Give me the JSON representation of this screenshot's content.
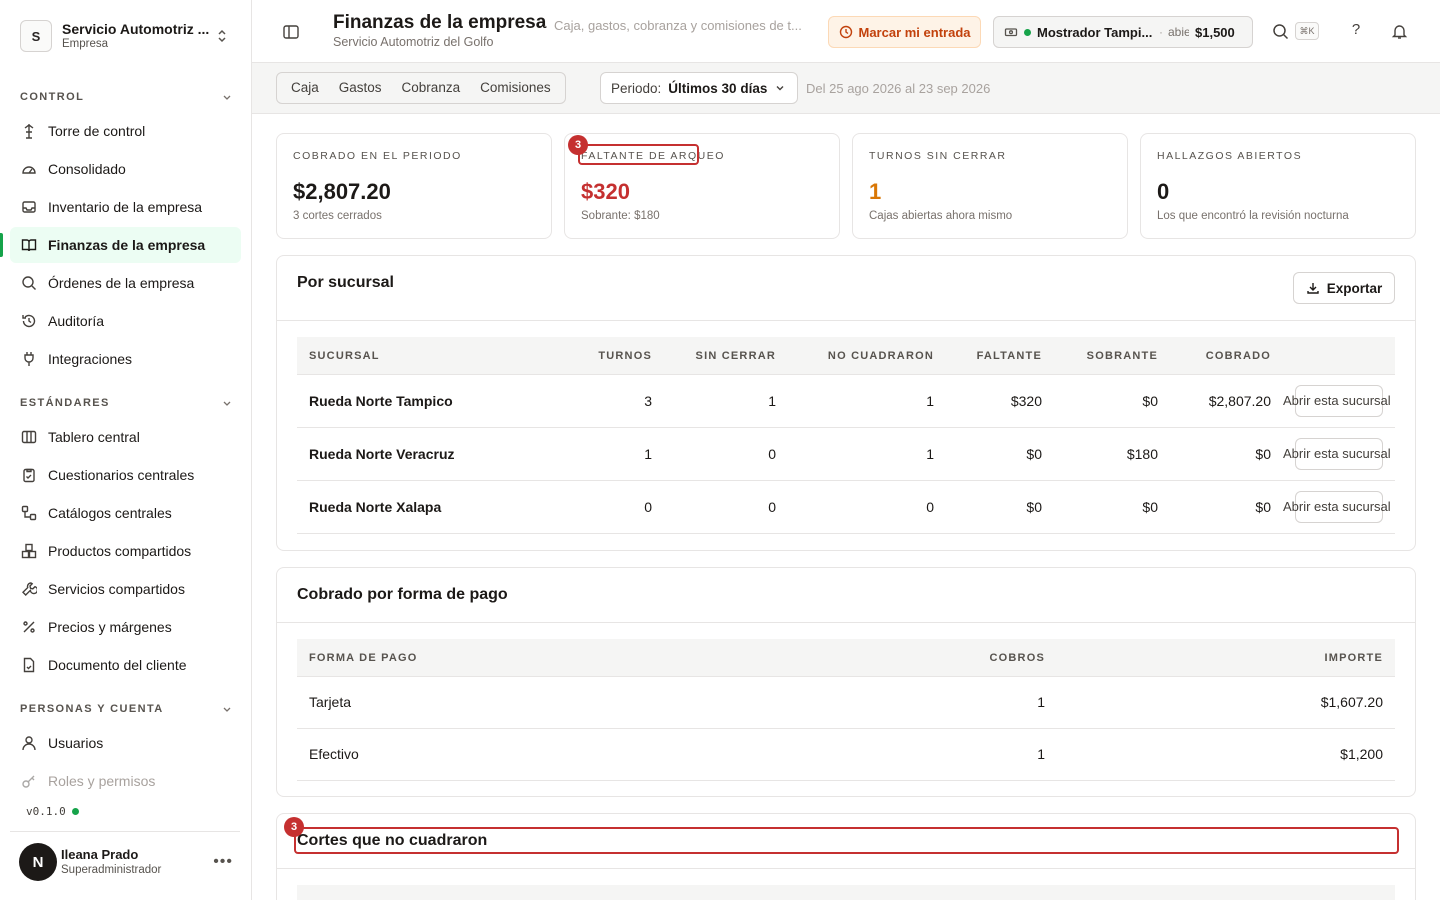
{
  "org": {
    "initial": "S",
    "name": "Servicio Automotriz ...",
    "type": "Empresa"
  },
  "sidebar": {
    "sections": [
      {
        "title": "CONTROL",
        "items": [
          "Torre de control",
          "Consolidado",
          "Inventario de la empresa",
          "Finanzas de la empresa",
          "Órdenes de la empresa",
          "Auditoría",
          "Integraciones"
        ]
      },
      {
        "title": "ESTÁNDARES",
        "items": [
          "Tablero central",
          "Cuestionarios centrales",
          "Catálogos centrales",
          "Productos compartidos",
          "Servicios compartidos",
          "Precios y márgenes",
          "Documento del cliente"
        ]
      },
      {
        "title": "PERSONAS Y CUENTA",
        "items": [
          "Usuarios",
          "Roles y permisos"
        ]
      }
    ],
    "active": "Finanzas de la empresa",
    "version": "v0.1.0",
    "user": {
      "initial": "N",
      "name": "Ileana Prado",
      "role": "Superadministrador"
    }
  },
  "header": {
    "title": "Finanzas de la empresa",
    "subtitle": "Servicio Automotriz del Golfo",
    "sep": "·",
    "description": "Caja, gastos, cobranza y comisiones de t...",
    "punch_label": "Marcar mi entrada",
    "register": {
      "name": "Mostrador Tampi...",
      "sep": "·",
      "status": "abie",
      "amount": "$1,500"
    },
    "kbd": "⌘K",
    "help": "?"
  },
  "subbar": {
    "tabs": [
      "Caja",
      "Gastos",
      "Cobranza",
      "Comisiones"
    ],
    "period_label": "Periodo:",
    "period_value": "Últimos 30 días",
    "range": "Del 25 ago 2026 al 23 sep 2026"
  },
  "kpis": [
    {
      "label": "COBRADO EN EL PERIODO",
      "value": "$2,807.20",
      "sub": "3 cortes cerrados"
    },
    {
      "label": "FALTANTE DE ARQUEO",
      "value": "$320",
      "sub": "Sobrante: $180"
    },
    {
      "label": "TURNOS SIN CERRAR",
      "value": "1",
      "sub": "Cajas abiertas ahora mismo"
    },
    {
      "label": "HALLAZGOS ABIERTOS",
      "value": "0",
      "sub": "Los que encontró la revisión nocturna"
    }
  ],
  "annotations": {
    "badge_kpi": "3",
    "badge_cortes": "3"
  },
  "branches": {
    "title": "Por sucursal",
    "export_label": "Exportar",
    "columns": [
      "SUCURSAL",
      "TURNOS",
      "SIN CERRAR",
      "NO CUADRARON",
      "FALTANTE",
      "SOBRANTE",
      "COBRADO"
    ],
    "rows": [
      {
        "name": "Rueda Norte Tampico",
        "turnos": "3",
        "sin_cerrar": "1",
        "no_cuadraron": "1",
        "faltante": "$320",
        "sobrante": "$0",
        "cobrado": "$2,807.20",
        "action": "Abrir esta sucursal"
      },
      {
        "name": "Rueda Norte Veracruz",
        "turnos": "1",
        "sin_cerrar": "0",
        "no_cuadraron": "1",
        "faltante": "$0",
        "sobrante": "$180",
        "cobrado": "$0",
        "action": "Abrir esta sucursal"
      },
      {
        "name": "Rueda Norte Xalapa",
        "turnos": "0",
        "sin_cerrar": "0",
        "no_cuadraron": "0",
        "faltante": "$0",
        "sobrante": "$0",
        "cobrado": "$0",
        "action": "Abrir esta sucursal"
      }
    ]
  },
  "payments": {
    "title": "Cobrado por forma de pago",
    "columns": [
      "FORMA DE PAGO",
      "COBROS",
      "IMPORTE"
    ],
    "rows": [
      {
        "method": "Tarjeta",
        "count": "1",
        "amount": "$1,607.20"
      },
      {
        "method": "Efectivo",
        "count": "1",
        "amount": "$1,200"
      }
    ]
  },
  "cortes": {
    "title": "Cortes que no cuadraron"
  },
  "colors": {
    "accent": "#16a34a",
    "danger": "#c53030",
    "warning": "#d97706",
    "punch_bg": "#fef3e7"
  }
}
